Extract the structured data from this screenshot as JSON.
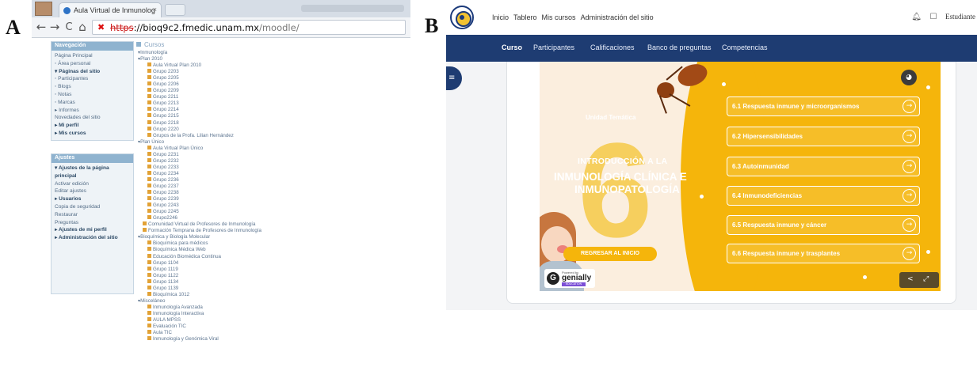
{
  "labels": {
    "a": "A",
    "b": "B"
  },
  "panel_a": {
    "tab_title": "Aula Virtual de Inmunolog",
    "tab_close": "×",
    "url_scheme": "https",
    "url_host": "://bioq9c2.fmedic.unam.mx",
    "url_path": "/moodle/",
    "nav_back": "←",
    "nav_forward": "→",
    "nav_reload": "C",
    "nav_home": "⌂",
    "navegacion": {
      "title": "Navegación",
      "items": [
        {
          "text": "Página Principal",
          "strong": false
        },
        {
          "text": "◦ Área personal",
          "strong": false
        },
        {
          "text": "▾ Páginas del sitio",
          "strong": true
        },
        {
          "text": "    ◦ Participantes",
          "strong": false
        },
        {
          "text": "    ◦ Blogs",
          "strong": false
        },
        {
          "text": "    ◦ Notas",
          "strong": false
        },
        {
          "text": "    ◦ Marcas",
          "strong": false
        },
        {
          "text": "    ▸ Informes",
          "strong": false
        },
        {
          "text": "    Novedades del sitio",
          "strong": false
        },
        {
          "text": "▸ Mi perfil",
          "strong": true
        },
        {
          "text": "▸ Mis cursos",
          "strong": true
        }
      ]
    },
    "ajustes": {
      "title": "Ajustes",
      "items": [
        {
          "text": "▾ Ajustes de la página",
          "strong": true
        },
        {
          "text": "   principal",
          "strong": true
        },
        {
          "text": "   Activar edición",
          "strong": false
        },
        {
          "text": "   Editar ajustes",
          "strong": false
        },
        {
          "text": "   ▸ Usuarios",
          "strong": true
        },
        {
          "text": "   Copia de seguridad",
          "strong": false
        },
        {
          "text": "   Restaurar",
          "strong": false
        },
        {
          "text": "   Preguntas",
          "strong": false
        },
        {
          "text": "",
          "strong": false
        },
        {
          "text": "▸ Ajustes de mi perfil",
          "strong": true
        },
        {
          "text": "",
          "strong": false
        },
        {
          "text": "▸ Administración del sitio",
          "strong": true
        }
      ]
    },
    "cursos_title": "Cursos",
    "tree": [
      {
        "t": "▾Inmunología",
        "lvl": 0,
        "leaf": false
      },
      {
        "t": "▾Plan 2010",
        "lvl": 0,
        "leaf": false
      },
      {
        "t": "Aula Virtual Plan 2010",
        "lvl": 1,
        "leaf": true
      },
      {
        "t": "Grupo 2203",
        "lvl": 1,
        "leaf": true
      },
      {
        "t": "Grupo 2205",
        "lvl": 1,
        "leaf": true
      },
      {
        "t": "Grupo 2206",
        "lvl": 1,
        "leaf": true
      },
      {
        "t": "Grupo 2209",
        "lvl": 1,
        "leaf": true
      },
      {
        "t": "Grupo 2211",
        "lvl": 1,
        "leaf": true
      },
      {
        "t": "Grupo 2213",
        "lvl": 1,
        "leaf": true
      },
      {
        "t": "Grupo 2214",
        "lvl": 1,
        "leaf": true
      },
      {
        "t": "Grupo 2215",
        "lvl": 1,
        "leaf": true
      },
      {
        "t": "Grupo 2218",
        "lvl": 1,
        "leaf": true
      },
      {
        "t": "Grupo 2220",
        "lvl": 1,
        "leaf": true
      },
      {
        "t": "Grupos de la Profa. Lilian Hernández",
        "lvl": 1,
        "leaf": true
      },
      {
        "t": "▾Plan Único",
        "lvl": 0,
        "leaf": false
      },
      {
        "t": "Aula Virtual Plan Único",
        "lvl": 1,
        "leaf": true
      },
      {
        "t": "Grupo 2231",
        "lvl": 1,
        "leaf": true
      },
      {
        "t": "Grupo 2232",
        "lvl": 1,
        "leaf": true
      },
      {
        "t": "Grupo 2233",
        "lvl": 1,
        "leaf": true
      },
      {
        "t": "Grupo 2234",
        "lvl": 1,
        "leaf": true
      },
      {
        "t": "Grupo 2236",
        "lvl": 1,
        "leaf": true
      },
      {
        "t": "Grupo 2237",
        "lvl": 1,
        "leaf": true
      },
      {
        "t": "Grupo 2238",
        "lvl": 1,
        "leaf": true
      },
      {
        "t": "Grupo 2239",
        "lvl": 1,
        "leaf": true
      },
      {
        "t": "Grupo 2243",
        "lvl": 1,
        "leaf": true
      },
      {
        "t": "Grupo 2245",
        "lvl": 1,
        "leaf": true
      },
      {
        "t": "Grupo2246",
        "lvl": 1,
        "leaf": true
      },
      {
        "t": "Comunidad Virtual de Profesores de Inmunología",
        "lvl": 0,
        "leaf": true
      },
      {
        "t": "Formación Temprana de Profesores de Inmunología",
        "lvl": 0,
        "leaf": true
      },
      {
        "t": "▾Bioquímica y Biología Molecular",
        "lvl": 0,
        "leaf": false
      },
      {
        "t": "Bioquímica para médicos",
        "lvl": 1,
        "leaf": true
      },
      {
        "t": "Bioquímica Médica Web",
        "lvl": 1,
        "leaf": true
      },
      {
        "t": "Educación Biomédica Continua",
        "lvl": 1,
        "leaf": true
      },
      {
        "t": "Grupo 1104",
        "lvl": 1,
        "leaf": true
      },
      {
        "t": "Grupo 1119",
        "lvl": 1,
        "leaf": true
      },
      {
        "t": "Grupo 1122",
        "lvl": 1,
        "leaf": true
      },
      {
        "t": "Grupo 1134",
        "lvl": 1,
        "leaf": true
      },
      {
        "t": "Grupo 1139",
        "lvl": 1,
        "leaf": true
      },
      {
        "t": "Bioquímica 1012",
        "lvl": 1,
        "leaf": true
      },
      {
        "t": "▾Misceláneo",
        "lvl": 0,
        "leaf": false
      },
      {
        "t": "Inmunología Avanzada",
        "lvl": 1,
        "leaf": true
      },
      {
        "t": "Inmunología Interactiva",
        "lvl": 1,
        "leaf": true
      },
      {
        "t": "AULA MPSS",
        "lvl": 1,
        "leaf": true
      },
      {
        "t": "Evaluación TIC",
        "lvl": 1,
        "leaf": true
      },
      {
        "t": "Aula TIC",
        "lvl": 1,
        "leaf": true
      },
      {
        "t": "Inmunología y Genómica Viral",
        "lvl": 1,
        "leaf": true
      }
    ]
  },
  "panel_b": {
    "topnav": [
      "Inicio",
      "Tablero",
      "Mis cursos",
      "Administración del sitio"
    ],
    "user": "Estudiante",
    "bell_icon": "♫",
    "chat_icon": "☐",
    "tabs": [
      "Curso",
      "Participantes",
      "Calificaciones",
      "Banco de preguntas",
      "Competencias"
    ],
    "drawer_icon": "≡",
    "genially": {
      "unidad": "Unidad Temática",
      "six": "6",
      "intro": "INTRODUCCIÓN A LA",
      "title_line1": "INMUNOLOGÍA CLÍNICA E",
      "title_line2": "INMUNOPATOLOGÍA",
      "back_button": "REGRESAR AL INICIO",
      "powered": "Powered by",
      "brand": "genially",
      "edition": "EDUCATION",
      "g_letter": "G",
      "share_symbol": "<",
      "expand_symbol": "⤢",
      "audio_symbol": "◕",
      "arrow_symbol": "→",
      "topics": [
        "6.1 Respuesta inmune y microorganismos",
        "6.2 Hipersensibilidades",
        "6.3 Autoinmunidad",
        "6.4 Inmunodeficiencias",
        "6.5 Respuesta inmune y cáncer",
        "6.6 Respuesta inmune y trasplantes"
      ]
    }
  },
  "colors": {
    "moodle_block_head": "#8fb3cf",
    "moodle_text": "#526b85",
    "navy": "#1e3c72",
    "genially_yellow": "#f5b50b",
    "genially_cream": "#fbeede"
  }
}
